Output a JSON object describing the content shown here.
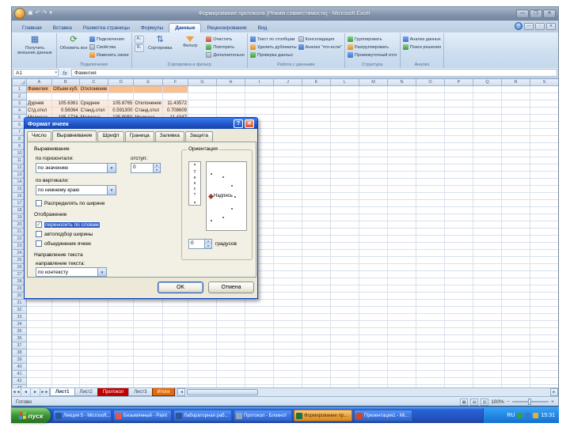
{
  "window": {
    "title": "Формирование протокола  [Режим совместимости]  -  Microsoft Excel",
    "minimize": "—",
    "maximize": "❐",
    "close": "✕"
  },
  "qat": {
    "save": "▣",
    "undo": "↶",
    "redo": "↷",
    "menu": "▾"
  },
  "ribbon": {
    "help": "?",
    "tabs": [
      "Главная",
      "Вставка",
      "Разметка страницы",
      "Формулы",
      "Данные",
      "Рецензирование",
      "Вид"
    ],
    "active_tab": "Данные",
    "groups": {
      "external": {
        "caption": "Получить внешние данные",
        "big_label": "Получить внешние данные",
        "icon": "▦"
      },
      "connections": {
        "caption": "Подключения",
        "big_label": "Обновить все",
        "icon": "⟳",
        "items": [
          "Подключения",
          "Свойства",
          "Изменить связи"
        ]
      },
      "sort": {
        "caption": "Сортировка и фильтр",
        "sort_asc": "А↓",
        "sort_desc": "Я↓",
        "sort_big": "Сортировка",
        "sort_icon": "⇅",
        "filter_big": "Фильтр",
        "items": [
          "Очистить",
          "Повторить",
          "Дополнительно"
        ]
      },
      "datatools": {
        "caption": "Работа с данными",
        "items": [
          "Текст по столбцам",
          "Удалить дубликаты",
          "Проверка данных",
          "Консолидация",
          "Анализ \"что-если\""
        ]
      },
      "outline": {
        "caption": "Структура",
        "items": [
          "Группировать",
          "Разгруппировать",
          "Промежуточный итог"
        ],
        "sum_icon": "∑"
      },
      "analysis": {
        "caption": "Анализ",
        "items": [
          "Анализ данных",
          "Поиск решения"
        ]
      }
    }
  },
  "formula_bar": {
    "cell_ref": "A1",
    "arrow": "▾",
    "fx": "fx",
    "content": "Фамилия"
  },
  "sheet": {
    "columns": [
      "A",
      "B",
      "C",
      "D",
      "E",
      "F",
      "G",
      "H",
      "I",
      "J",
      "K",
      "L",
      "M",
      "N",
      "O",
      "P",
      "Q",
      "R",
      "S"
    ],
    "row_count": 48,
    "header_row": {
      "row": 1,
      "values": [
        "Фамилия",
        "Объем куб.",
        "Отклонение",
        "",
        "",
        ""
      ]
    },
    "data_rows": [
      {
        "row": 3,
        "values": [
          "Дурнев",
          "105.6361",
          "Среднее",
          "105.8765",
          "Отклонение",
          "11.43572"
        ]
      },
      {
        "row": 4,
        "values": [
          "Стд.откл",
          "0.56064",
          "Станд.откл",
          "0.591300",
          "Станд.откл",
          "0.708609"
        ]
      },
      {
        "row": 5,
        "values": [
          "Медиана",
          "105.1726",
          "Медиана",
          "105.9050",
          "Медиана",
          "11.4347"
        ]
      }
    ]
  },
  "dialog": {
    "title": "Формат ячеек",
    "help": "?",
    "close": "✕",
    "tabs": [
      "Число",
      "Выравнивание",
      "Шрифт",
      "Граница",
      "Заливка",
      "Защита"
    ],
    "active_tab": "Выравнивание",
    "section_alignment": "Выравнивание",
    "horizontal_label": "по горизонтали:",
    "horizontal_value": "по значению",
    "indent_label": "отступ:",
    "indent_value": "0",
    "vertical_label": "по вертикали:",
    "vertical_value": "по нижнему краю",
    "justify_checkbox": "Распределять по ширине",
    "section_display": "Отображение",
    "wrap_checkbox": "переносить по словам",
    "shrink_checkbox": "автоподбор ширины",
    "merge_checkbox": "объединение ячеек",
    "section_rtl": "Направление текста",
    "direction_label": "направление текста:",
    "direction_value": "по контексту",
    "orientation_caption": "Ориентация",
    "orientation_side_text": "Текст",
    "orientation_main_text": "Надпись",
    "check_glyph": "✓",
    "degrees_value": "0",
    "degrees_label": "градусов",
    "ok": "OK",
    "cancel": "Отмена"
  },
  "sheet_tabs": {
    "nav": [
      "◄◄",
      "◄",
      "►",
      "►►"
    ],
    "tabs": [
      {
        "label": "Лист1",
        "active": true
      },
      {
        "label": "Лист2"
      },
      {
        "label": "Протокол",
        "color": "#c00000"
      },
      {
        "label": "Лист3"
      },
      {
        "label": "Итоги",
        "color": "#e36c09"
      }
    ]
  },
  "status_bar": {
    "ready": "Готово",
    "views": [
      "▦",
      "▤",
      "▥"
    ],
    "zoom_out": "−",
    "zoom": "100%",
    "zoom_in": "+"
  },
  "taskbar": {
    "start": "пуск",
    "items": [
      {
        "label": "Лекция 5 - Microsoft...",
        "app": "word"
      },
      {
        "label": "Безымянный - Paint",
        "app": "paint"
      },
      {
        "label": "Лабораторная раб...",
        "app": "word"
      },
      {
        "label": "Протокол - Блокнот",
        "app": "notepad"
      },
      {
        "label": "Формирование пр...",
        "app": "excel",
        "active": true
      },
      {
        "label": "Презентация1 - Mi...",
        "app": "ppt"
      }
    ],
    "tray": {
      "lang": "RU",
      "time": "15:31"
    }
  }
}
